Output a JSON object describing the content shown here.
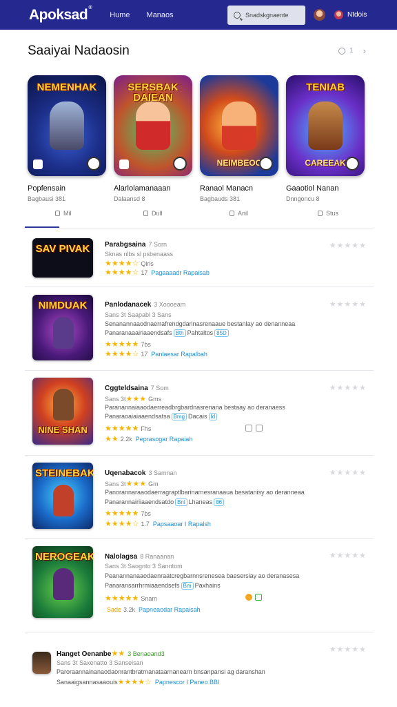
{
  "app": {
    "logo": "Apoksad",
    "logo_mark": "®"
  },
  "nav": [
    "Hume",
    "Manaos"
  ],
  "search": {
    "placeholder": "Snadskgnaente"
  },
  "user": {
    "name": "Ntdois"
  },
  "page": {
    "title": "Saaiyai Nadaosin",
    "pager_text": "1"
  },
  "featured": [
    {
      "title": "Popfensain",
      "sub": "Bagbausi  381",
      "art_title": "NEMENHAK",
      "art_title2": ""
    },
    {
      "title": "Alarlolamanaaan",
      "sub": "Dalaansd  8",
      "art_title": "SERSBAK DAIEAN",
      "art_title2": ""
    },
    {
      "title": "Ranaol  Manacn",
      "sub": "Bagbauds  381",
      "art_title": "",
      "art_title2": "NEIMBEOC"
    },
    {
      "title": "Gaaotiol  Nanan",
      "sub": "Dnngoncu  8",
      "art_title": "TENIAB",
      "art_title2": "CAREEAK"
    }
  ],
  "tabs": [
    "Mil",
    "Dull",
    "Anil",
    "Stus"
  ],
  "games": [
    {
      "title": "Parabgsaina",
      "meta": "7 Sorn",
      "line1": "Sknas nlbs sl psbenaass",
      "line2_count": "Qiris",
      "line3_count": "17",
      "link": "Pagaaaadr  Rapaisab",
      "thumb_title": "SAV PIVAK"
    },
    {
      "title": "Panlodanacek",
      "meta": "3 Xoooeam",
      "line1": "Sans 3t  Saapabl  3  Sans",
      "desc": "Senanannaaodnaerrafrendgdarinasrenaaue bestanlay ao denanneaa",
      "desc2": "Panaranaaairiaaendsafs",
      "chip1": "Bth",
      "chip1b": "Pahtaltos",
      "chip1c": "85D",
      "line2_count": "7bs",
      "line3_count": "17",
      "link": "Panlaesar  Rapalbah",
      "thumb_title": "NIMDUAK"
    },
    {
      "title": "Cggteldsaina",
      "meta": "7 Som",
      "line1": "Sans 3t",
      "line1_count": "Gms",
      "desc": "Paranannaiaaodaerreadbrgbardnasrenana bestaay ao deranaess",
      "desc2": "Panaraoaiaiaaendsatsa",
      "chip1": "Bmg",
      "chip1b": "Dacais",
      "chip1c": "Id",
      "line2_count": "Fhs",
      "line3_count": "2.2k",
      "link": "Peprasogar  Rapaiah",
      "thumb_title": "NINE SHAN"
    },
    {
      "title": "Uqenabacok",
      "meta": "3 Samnan",
      "line1": "Sans 3t",
      "line1_count": "Gm",
      "desc": "Panorannaraaodaerragraptlbarinarnesranaaua besatanisy ao deranneaa",
      "desc2": "Panarannairiiaaendsatdo",
      "chip1": "Bnl",
      "chip1b": "Lhaneas",
      "chip1c": "86",
      "line2_count": "7bs",
      "line3_count": "1.7",
      "link": "Papsaaoar  I Rapalsh",
      "thumb_title": "STEINEBAK"
    },
    {
      "title": "Nalolagsa",
      "meta": "8 Ranaanan",
      "line1": "Sans 3t  Saognto  3  Sanntom",
      "desc": "Peanannanaaodaenraatcregbarnnsrenesea baesersiay ao deranasesa",
      "desc2": "Panaransarrhrmiaaendsefs",
      "chip1": "Bm",
      "chip1b": "Paxhains",
      "chip1c": "",
      "line2_count": "Snam",
      "line3_count": "3.2k",
      "link": "Papneaodar  Rapaisah",
      "line3_prefix": "Sade",
      "thumb_title": "NEROGEAK"
    },
    {
      "title": "Hanget  Oenanbe",
      "meta": "3 Benaoand3",
      "line1": "Sans 3t  Saxenatto  3  Sanseisan",
      "desc": "Paroraannainanaodaonrantbratrnanataarnanearn bnsanpansi  ag daranshan",
      "desc2": "Sanaaigsannasaaouis",
      "link": "Papnescor  I Paneo  BBI",
      "thumb_title": ""
    }
  ],
  "colors": {
    "header": "#25288e",
    "accent": "#2b3a9a",
    "star": "#f5b400",
    "link": "#1d8fcf"
  }
}
